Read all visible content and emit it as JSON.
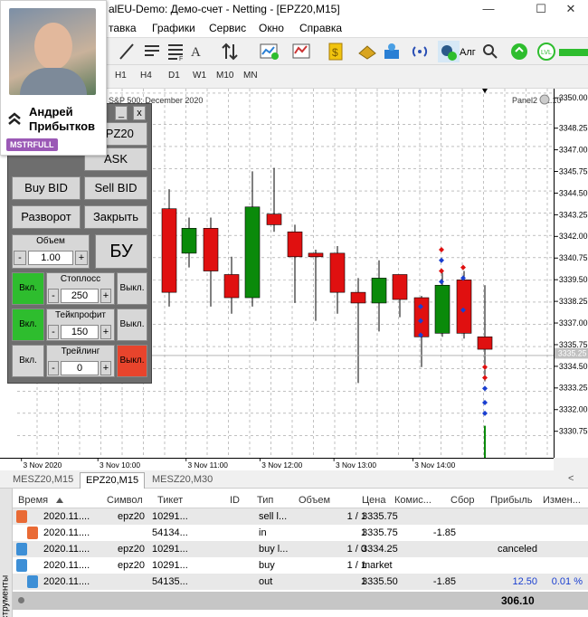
{
  "window": {
    "title": "alEU-Demo: Демо-счет - Netting - [EPZ20,M15]",
    "min_label": "—",
    "max_label": "☐",
    "close_label": "✕"
  },
  "menu": [
    "тавка",
    "Графики",
    "Сервис",
    "Окно",
    "Справка"
  ],
  "toolbar": {
    "algo_label": "Алг"
  },
  "timeframes": [
    "H1",
    "H4",
    "D1",
    "W1",
    "M10",
    "MN"
  ],
  "profile": {
    "name_line1": "Андрей",
    "name_line2": "Прибытков",
    "badge": "MSTRFULL"
  },
  "chart": {
    "title": "S&P 500: December 2020",
    "panel_version": "Panel2 v.1.10",
    "current_price_label": "3335.25"
  },
  "chart_data": {
    "type": "candlestick",
    "title": "S&P 500: December 2020",
    "y_ticks": [
      "3350.00",
      "3348.25",
      "3347.00",
      "3345.75",
      "3344.50",
      "3343.25",
      "3342.00",
      "3340.75",
      "3339.50",
      "3338.25",
      "3337.00",
      "3335.75",
      "3334.50",
      "3333.25",
      "3332.00",
      "3330.75"
    ],
    "x_ticks": [
      "3 Nov 2020",
      "3 Nov 10:00",
      "3 Nov 11:00",
      "3 Nov 12:00",
      "3 Nov 13:00",
      "3 Nov 14:00"
    ],
    "ylim": [
      3329.5,
      3350.25
    ],
    "current_price": 3335.25,
    "grid": true,
    "candles": [
      {
        "o": 3336.6,
        "c": 3335.0,
        "h": 3337.4,
        "l": 3334.6
      },
      {
        "o": 3343.5,
        "c": 3338.8,
        "h": 3344.6,
        "l": 3338.0
      },
      {
        "o": 3341.0,
        "c": 3342.4,
        "h": 3343.0,
        "l": 3340.2
      },
      {
        "o": 3342.4,
        "c": 3340.0,
        "h": 3343.0,
        "l": 3338.0
      },
      {
        "o": 3339.8,
        "c": 3338.5,
        "h": 3340.8,
        "l": 3337.6
      },
      {
        "o": 3338.5,
        "c": 3343.6,
        "h": 3345.6,
        "l": 3338.0
      },
      {
        "o": 3343.2,
        "c": 3342.6,
        "h": 3345.8,
        "l": 3342.2
      },
      {
        "o": 3342.2,
        "c": 3340.8,
        "h": 3342.6,
        "l": 3338.2
      },
      {
        "o": 3341.0,
        "c": 3340.8,
        "h": 3341.2,
        "l": 3337.2
      },
      {
        "o": 3341.0,
        "c": 3338.8,
        "h": 3341.4,
        "l": 3337.6
      },
      {
        "o": 3338.8,
        "c": 3338.2,
        "h": 3339.6,
        "l": 3333.7
      },
      {
        "o": 3338.2,
        "c": 3339.6,
        "h": 3340.6,
        "l": 3336.6
      },
      {
        "o": 3339.8,
        "c": 3338.4,
        "h": 3339.8,
        "l": 3337.4
      },
      {
        "o": 3338.5,
        "c": 3336.3,
        "h": 3338.6,
        "l": 3334.6
      },
      {
        "o": 3336.5,
        "c": 3339.2,
        "h": 3339.9,
        "l": 3336.3
      },
      {
        "o": 3339.5,
        "c": 3336.5,
        "h": 3340.0,
        "l": 3336.2
      },
      {
        "o": 3336.3,
        "c": 3335.6,
        "h": 3339.2,
        "l": 3333.8
      }
    ],
    "last_bar": {
      "o": 3331.3,
      "c": 3330.5,
      "h": 3331.3,
      "l": 3330.0
    }
  },
  "panel": {
    "top_left_label": "EPZ20",
    "ask_label": "ASK",
    "buy_bid": "Buy BID",
    "sell_bid": "Sell BID",
    "reverse": "Разворот",
    "close": "Закрыть",
    "volume_label": "Объем",
    "volume_value": "1.00",
    "minus": "-",
    "plus": "+",
    "be_label": "БУ",
    "on_label": "Вкл.",
    "off_label": "Выкл.",
    "stoploss_label": "Стоплосс",
    "stoploss_value": "250",
    "takeprofit_label": "Тейкпрофит",
    "takeprofit_value": "150",
    "trailing_label": "Трейлинг",
    "trailing_value": "0",
    "win_min": "_",
    "win_close": "x"
  },
  "chart_tabs": [
    "MESZ20,M15",
    "EPZ20,M15",
    "MESZ20,M30"
  ],
  "toolbox": {
    "side_label": "струменты",
    "columns": [
      "Время",
      "Символ",
      "Тикет",
      "ID",
      "Тип",
      "Объем",
      "Цена",
      "Комис...",
      "Сбор",
      "Прибыль",
      "Измен..."
    ],
    "rows": [
      {
        "time": "2020.11....",
        "symbol": "epz20",
        "ticket": "10291...",
        "id": "",
        "type": "sell l...",
        "volume": "1 / 1",
        "price": "3335.75",
        "commission": "",
        "fee": "",
        "profit": "",
        "change": "",
        "icon": "order"
      },
      {
        "time": "2020.11....",
        "symbol": "",
        "ticket": "54134...",
        "id": "",
        "type": "in",
        "volume": "1",
        "price": "3335.75",
        "commission": "-1.85",
        "fee": "",
        "profit": "",
        "change": "",
        "icon": "deal-in"
      },
      {
        "time": "2020.11....",
        "symbol": "epz20",
        "ticket": "10291...",
        "id": "",
        "type": "buy l...",
        "volume": "1 / 0",
        "price": "3334.25",
        "commission": "",
        "fee": "",
        "profit": "canceled",
        "change": "",
        "icon": "order-blue"
      },
      {
        "time": "2020.11....",
        "symbol": "epz20",
        "ticket": "10291...",
        "id": "",
        "type": "buy",
        "volume": "1 / 1",
        "price": "market",
        "commission": "",
        "fee": "",
        "profit": "",
        "change": "",
        "icon": "order-blue"
      },
      {
        "time": "2020.11....",
        "symbol": "",
        "ticket": "54135...",
        "id": "",
        "type": "out",
        "volume": "1",
        "price": "3335.50",
        "commission": "-1.85",
        "fee": "",
        "profit": "12.50",
        "change": "0.01 %",
        "icon": "deal-out"
      }
    ],
    "total": "306.10"
  },
  "colors": {
    "bull": "#0a8a0a",
    "bear": "#e01010",
    "panel_green": "#2ebd2e",
    "panel_red": "#e8442c",
    "badge": "#9b59b6"
  }
}
